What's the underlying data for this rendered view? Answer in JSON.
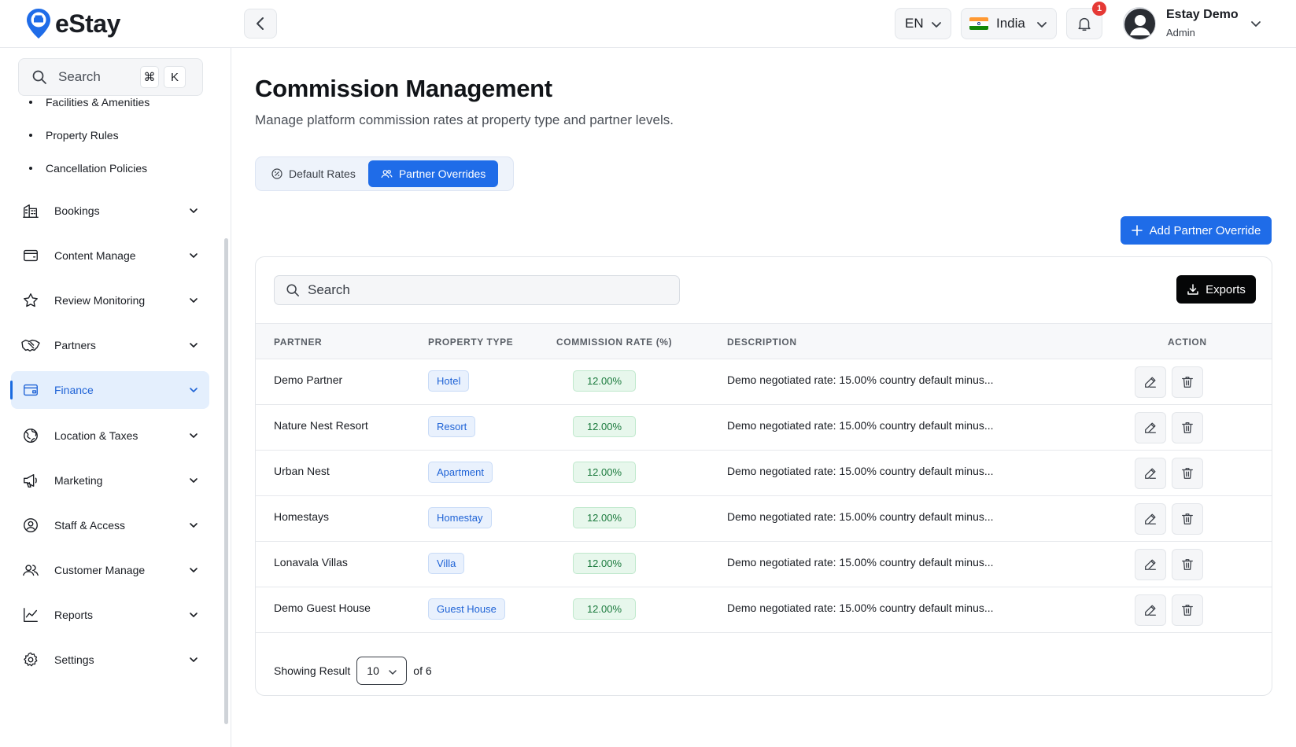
{
  "app": {
    "name": "eStay"
  },
  "header": {
    "language": "EN",
    "country": "India",
    "notification_count": "1",
    "user": {
      "name": "Estay Demo",
      "role": "Admin"
    }
  },
  "sidebar": {
    "search_placeholder": "Search",
    "shortcut_keys": [
      "⌘",
      "K"
    ],
    "sub_items": [
      {
        "label": "Facilities & Amenities"
      },
      {
        "label": "Property Rules"
      },
      {
        "label": "Cancellation Policies"
      }
    ],
    "items": [
      {
        "label": "Bookings",
        "icon": "building-icon"
      },
      {
        "label": "Content Manage",
        "icon": "wallet-icon"
      },
      {
        "label": "Review Monitoring",
        "icon": "star-icon"
      },
      {
        "label": "Partners",
        "icon": "handshake-icon"
      },
      {
        "label": "Finance",
        "icon": "wallet-icon",
        "active": true
      },
      {
        "label": "Location & Taxes",
        "icon": "globe-icon"
      },
      {
        "label": "Marketing",
        "icon": "megaphone-icon"
      },
      {
        "label": "Staff & Access",
        "icon": "user-circle-icon"
      },
      {
        "label": "Customer Manage",
        "icon": "users-icon"
      },
      {
        "label": "Reports",
        "icon": "chart-line-icon"
      },
      {
        "label": "Settings",
        "icon": "gear-icon"
      }
    ]
  },
  "page": {
    "title": "Commission Management",
    "subtitle": "Manage platform commission rates at property type and partner levels."
  },
  "tabs": [
    {
      "label": "Default Rates",
      "active": false
    },
    {
      "label": "Partner Overrides",
      "active": true
    }
  ],
  "actions": {
    "add_label": "Add Partner Override",
    "export_label": "Exports"
  },
  "table": {
    "search_placeholder": "Search",
    "columns": [
      "PARTNER",
      "PROPERTY TYPE",
      "COMMISSION RATE (%)",
      "DESCRIPTION",
      "ACTION"
    ],
    "rows": [
      {
        "partner": "Demo Partner",
        "property_type": "Hotel",
        "rate": "12.00%",
        "description": "Demo negotiated rate: 15.00% country default minus..."
      },
      {
        "partner": "Nature Nest Resort",
        "property_type": "Resort",
        "rate": "12.00%",
        "description": "Demo negotiated rate: 15.00% country default minus..."
      },
      {
        "partner": "Urban Nest",
        "property_type": "Apartment",
        "rate": "12.00%",
        "description": "Demo negotiated rate: 15.00% country default minus..."
      },
      {
        "partner": "Homestays",
        "property_type": "Homestay",
        "rate": "12.00%",
        "description": "Demo negotiated rate: 15.00% country default minus..."
      },
      {
        "partner": "Lonavala Villas",
        "property_type": "Villa",
        "rate": "12.00%",
        "description": "Demo negotiated rate: 15.00% country default minus..."
      },
      {
        "partner": "Demo Guest House",
        "property_type": "Guest House",
        "rate": "12.00%",
        "description": "Demo negotiated rate: 15.00% country default minus..."
      }
    ],
    "footer": {
      "prefix": "Showing Result",
      "page_size": "10",
      "suffix": "of 6"
    }
  },
  "colors": {
    "primary": "#1f6ce8",
    "active_nav_bg": "#e4effd",
    "rate_bg": "#e7f7ec",
    "type_bg": "#e9f1fd",
    "badge": "#e53935"
  }
}
